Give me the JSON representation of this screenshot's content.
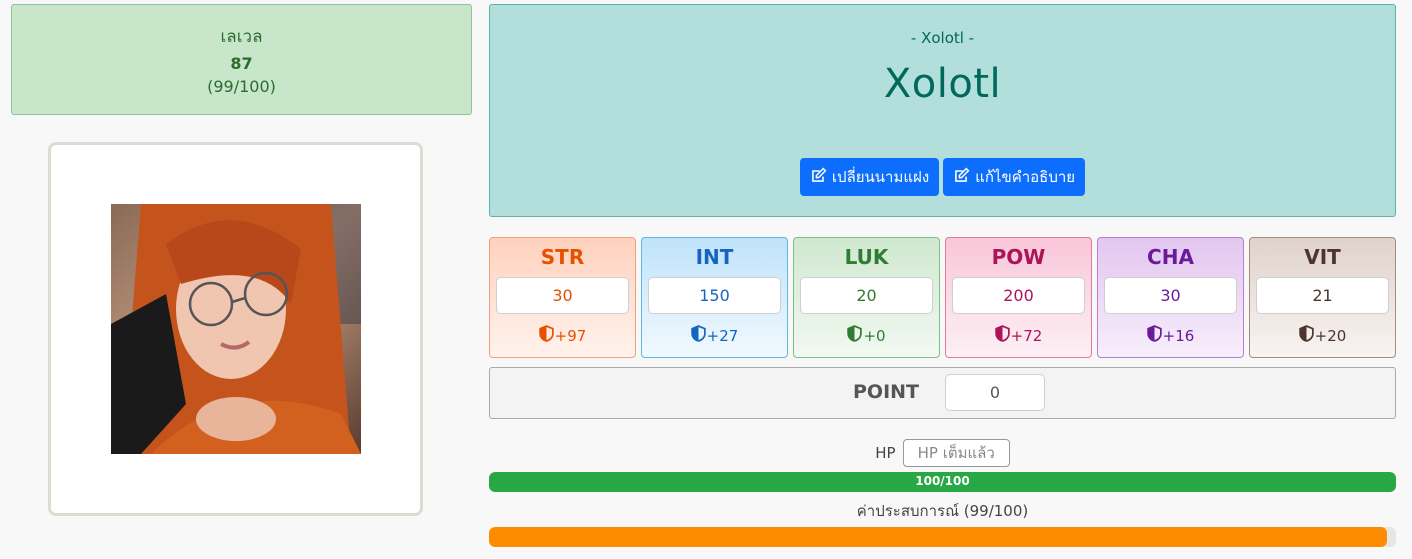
{
  "level": {
    "label": "เลเวล",
    "value": "87",
    "progress": "(99/100)"
  },
  "profile": {
    "subtitle": "- Xolotl -",
    "name": "Xolotl",
    "buttons": {
      "change_alias": "เปลี่ยนนามแฝง",
      "edit_description": "แก้ไขคำอธิบาย"
    }
  },
  "stats": [
    {
      "name": "STR",
      "value": "30",
      "bonus": "+97",
      "color": "#e65100"
    },
    {
      "name": "INT",
      "value": "150",
      "bonus": "+27",
      "color": "#1565c0"
    },
    {
      "name": "LUK",
      "value": "20",
      "bonus": "+0",
      "color": "#2e7d32"
    },
    {
      "name": "POW",
      "value": "200",
      "bonus": "+72",
      "color": "#ad1457"
    },
    {
      "name": "CHA",
      "value": "30",
      "bonus": "+16",
      "color": "#6a1b9a"
    },
    {
      "name": "VIT",
      "value": "21",
      "bonus": "+20",
      "color": "#4e342e"
    }
  ],
  "point": {
    "label": "POINT",
    "value": "0"
  },
  "hp": {
    "label": "HP",
    "button": "HP เต็มแล้ว",
    "text": "100/100",
    "fraction": 1.0
  },
  "exp": {
    "label": "ค่าประสบการณ์ (99/100)",
    "fraction": 0.99
  }
}
